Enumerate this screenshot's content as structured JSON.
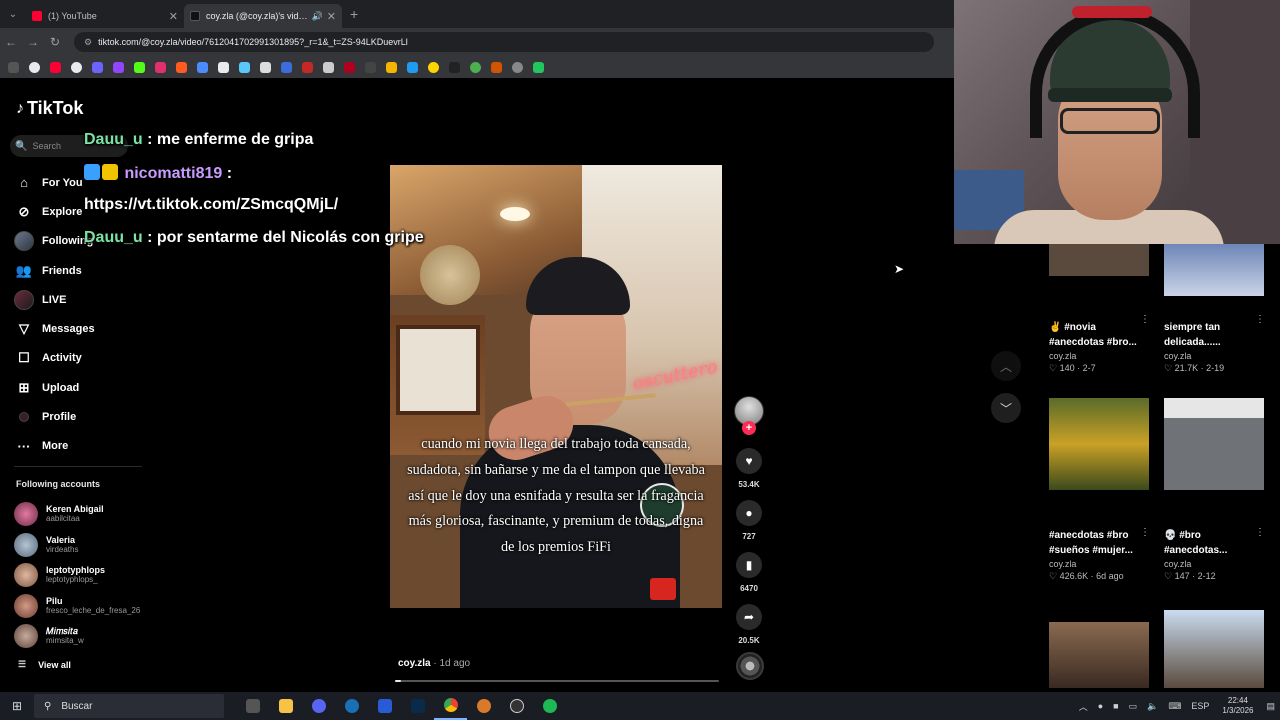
{
  "browser": {
    "tabs": [
      {
        "title": "(1) YouTube",
        "favicon_color": "#ff0033",
        "active": false
      },
      {
        "title": "coy.zla (@coy.zla)'s video o",
        "favicon_color": "#111111",
        "active": true
      }
    ],
    "url": "tiktok.com/@coy.zla/video/7612041702991301895?_r=1&_t=ZS-94LKDuevrLl"
  },
  "tiktok": {
    "logo": "TikTok",
    "search_placeholder": "Search",
    "nav": [
      {
        "label": "For You",
        "icon": "home-icon"
      },
      {
        "label": "Explore",
        "icon": "compass-icon"
      },
      {
        "label": "Following",
        "icon": "avatar-icon"
      },
      {
        "label": "Friends",
        "icon": "friends-icon"
      },
      {
        "label": "LIVE",
        "icon": "live-icon"
      },
      {
        "label": "Messages",
        "icon": "send-icon"
      },
      {
        "label": "Activity",
        "icon": "activity-icon"
      },
      {
        "label": "Upload",
        "icon": "upload-icon"
      },
      {
        "label": "Profile",
        "icon": "profile-icon"
      },
      {
        "label": "More",
        "icon": "more-icon"
      }
    ],
    "following_header": "Following accounts",
    "following": [
      {
        "name": "Keren Abigail",
        "user": "aabilcitaa",
        "color": "#c94f7c"
      },
      {
        "name": "Valeria",
        "user": "virdeaths",
        "color": "#7a8ea0"
      },
      {
        "name": "leptotyphlops",
        "user": "leptotyphlops_",
        "color": "#b08b74"
      },
      {
        "name": "Pilu",
        "user": "fresco_leche_de_fresa_26",
        "color": "#a06a58"
      },
      {
        "name": "𝑀𝑖𝑚𝑠𝑖𝑡𝑎",
        "user": "mimsita_w",
        "color": "#8a6f63"
      }
    ],
    "view_all": "View all"
  },
  "chat": [
    {
      "user": "Dauu_u",
      "text": ": me enferme de gripa"
    },
    {
      "user": "nicomatti819",
      "text": ":"
    },
    {
      "user": "",
      "text": "https://vt.tiktok.com/ZSmcqQMjL/"
    },
    {
      "user": "Dauu_u",
      "text": ": por sentarme del Nicolás con gripe"
    }
  ],
  "video": {
    "neon_text": "oscuttero",
    "caption": "cuando mi novia llega del trabajo toda cansada, sudadota, sin bañarse y me da el tampon que llevaba así que le doy una esnifada y resulta ser la fragancia más gloriosa, fascinante, y premium de todas, digna de los premios FiFi",
    "author": "coy.zla",
    "age": " · 1d ago",
    "progress": 0.02,
    "likes": "53.4K",
    "comments": "727",
    "saves": "6470",
    "shares": "20.5K"
  },
  "grid": [
    {
      "title": "✌️ #novia #anecdotas #bro...",
      "author": "coy.zla",
      "stats": "♡ 140 · 2-7",
      "thumb": "#5a4a3e"
    },
    {
      "title": "siempre tan delicada......",
      "author": "coy.zla",
      "stats": "♡ 21.7K · 2-19",
      "thumb": "#8fa0c4"
    },
    {
      "title": "#anecdotas #bro #sueños #mujer...",
      "author": "coy.zla",
      "stats": "♡ 426.6K · 6d ago",
      "thumb": "#6b7a2f"
    },
    {
      "title": "💀 #bro #anecdotas...",
      "author": "coy.zla",
      "stats": "♡ 147 · 2-12",
      "thumb": "#6d6f75"
    },
    {
      "title": "",
      "author": "",
      "stats": "",
      "thumb": "#6a5141"
    },
    {
      "title": "",
      "author": "",
      "stats": "",
      "thumb": "#9fb7cf"
    }
  ],
  "taskbar": {
    "search": "Buscar",
    "lang": "ESP",
    "time": "22:44",
    "date": "1/3/2026"
  }
}
